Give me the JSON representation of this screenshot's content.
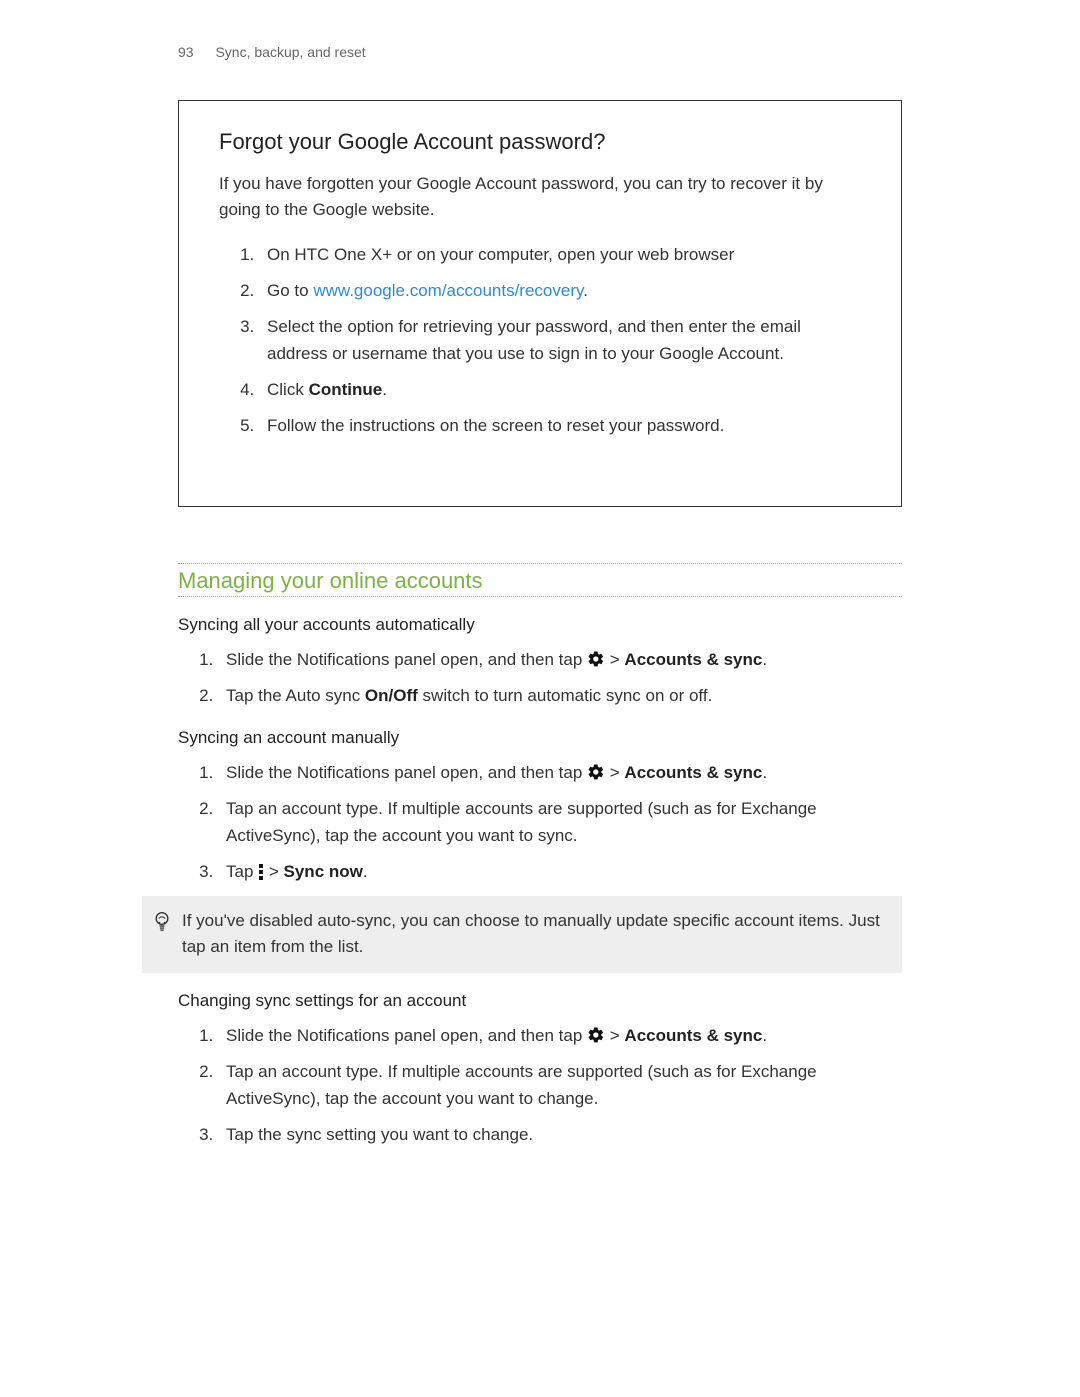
{
  "header": {
    "page_number": "93",
    "chapter": "Sync, backup, and reset"
  },
  "box": {
    "title": "Forgot your Google Account password?",
    "intro": "If you have forgotten your Google Account password, you can try to recover it by going to the Google website.",
    "steps": {
      "s1": "On HTC One X+ or on your computer, open your web browser",
      "s2_pre": "Go to ",
      "s2_link": "www.google.com/accounts/recovery",
      "s2_post": ".",
      "s3": "Select the option for retrieving your password, and then enter the email address or username that you use to sign in to your Google Account.",
      "s4_pre": "Click ",
      "s4_bold": "Continue",
      "s4_post": ".",
      "s5": "Follow the instructions on the screen to reset your password."
    }
  },
  "section": {
    "title": "Managing your online accounts",
    "sub1": {
      "heading": "Syncing all your accounts automatically",
      "s1_pre": "Slide the Notifications panel open, and then tap ",
      "s1_mid": " > ",
      "s1_bold": "Accounts & sync",
      "s1_post": ".",
      "s2_pre": "Tap the Auto sync ",
      "s2_bold": "On/Off",
      "s2_post": " switch to turn automatic sync on or off."
    },
    "sub2": {
      "heading": "Syncing an account manually",
      "s1_pre": "Slide the Notifications panel open, and then tap ",
      "s1_mid": " > ",
      "s1_bold": "Accounts & sync",
      "s1_post": ".",
      "s2": "Tap an account type. If multiple accounts are supported (such as for Exchange ActiveSync), tap the account you want to sync.",
      "s3_pre": "Tap ",
      "s3_mid": " > ",
      "s3_bold": "Sync now",
      "s3_post": "."
    },
    "tip": "If you've disabled auto-sync, you can choose to manually update specific account items. Just tap an item from the list.",
    "sub3": {
      "heading": "Changing sync settings for an account",
      "s1_pre": "Slide the Notifications panel open, and then tap ",
      "s1_mid": " > ",
      "s1_bold": "Accounts & sync",
      "s1_post": ".",
      "s2": "Tap an account type. If multiple accounts are supported (such as for Exchange ActiveSync), tap the account you want to change.",
      "s3": "Tap the sync setting you want to change."
    }
  }
}
